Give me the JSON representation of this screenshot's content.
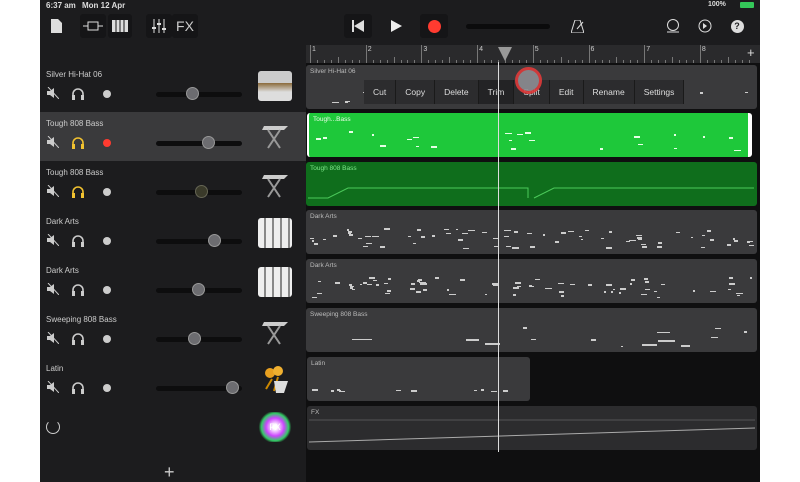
{
  "status": {
    "time": "6:37 am",
    "date": "Mon 12 Apr",
    "battery": "100%"
  },
  "toolbar": {
    "fx_label": "FX",
    "icons": [
      "document-icon",
      "tracks-view-icon",
      "keyboard-icon",
      "mixer-icon",
      "rewind-icon",
      "play-icon",
      "record-icon",
      "metronome-icon",
      "loop-icon",
      "settings-icon",
      "help-icon"
    ]
  },
  "colors": {
    "accent_green": "#1ec83a",
    "dark_green": "#0f6e1c",
    "record_red": "#ff3b30",
    "solo_yellow": "#f2c230"
  },
  "ruler": {
    "bars": [
      "1",
      "2",
      "3",
      "4",
      "5",
      "6",
      "7",
      "8"
    ],
    "add": "+"
  },
  "tracks": [
    {
      "name": "Silver Hi-Hat 06",
      "volume": 0.45,
      "selected": false,
      "solo": false,
      "armed": false,
      "instrument": "drum-machine-icon"
    },
    {
      "name": "Tough 808 Bass",
      "volume": 0.65,
      "selected": true,
      "solo": true,
      "armed": true,
      "instrument": "keyboard-stand-icon"
    },
    {
      "name": "Tough 808 Bass",
      "volume": 0.56,
      "selected": false,
      "solo": true,
      "armed": false,
      "instrument": "keyboard-stand-icon"
    },
    {
      "name": "Dark Arts",
      "volume": 0.73,
      "selected": false,
      "solo": false,
      "armed": false,
      "instrument": "drum-pad-icon"
    },
    {
      "name": "Dark Arts",
      "volume": 0.53,
      "selected": false,
      "solo": false,
      "armed": false,
      "instrument": "drum-pad-icon"
    },
    {
      "name": "Sweeping 808 Bass",
      "volume": 0.48,
      "selected": false,
      "solo": false,
      "armed": false,
      "instrument": "keyboard-stand-icon"
    },
    {
      "name": "Latin",
      "volume": 0.95,
      "selected": false,
      "solo": false,
      "armed": false,
      "instrument": "maracas-icon"
    }
  ],
  "fx_track": {
    "instrument_label": "FX"
  },
  "regions": [
    {
      "label": "Silver Hi-Hat 06"
    },
    {
      "label": "Tough...Bass"
    },
    {
      "label": "Tough 808 Bass"
    },
    {
      "label": "Dark Arts"
    },
    {
      "label": "Dark Arts"
    },
    {
      "label": "Sweeping 808 Bass"
    },
    {
      "label": "Latin"
    },
    {
      "label": "FX"
    }
  ],
  "context_menu": [
    "Cut",
    "Copy",
    "Delete",
    "Trim",
    "Split",
    "Edit",
    "Rename",
    "Settings"
  ],
  "add_track": "+"
}
